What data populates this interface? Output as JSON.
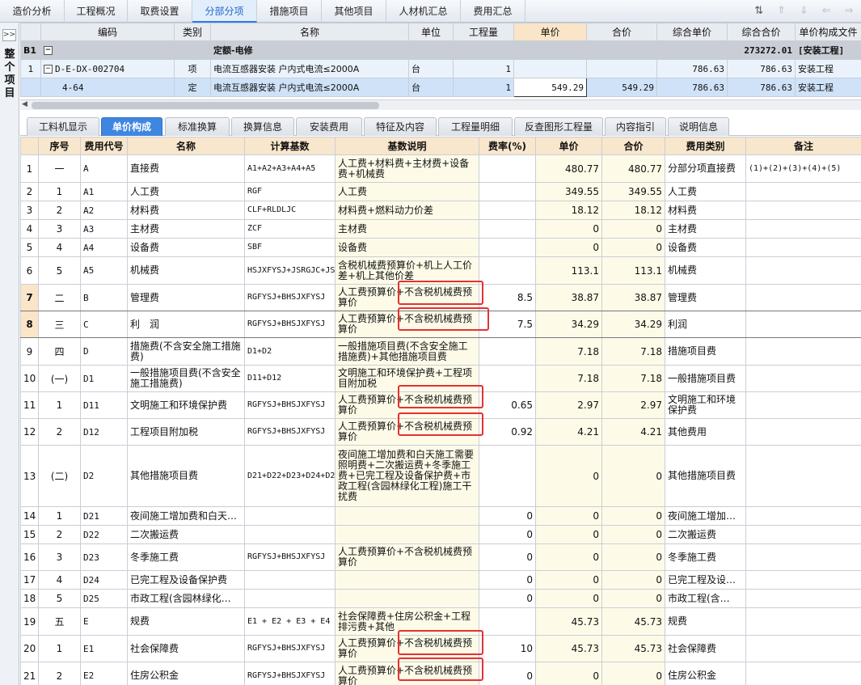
{
  "top_tabs": [
    {
      "label": "造价分析",
      "active": false
    },
    {
      "label": "工程概况",
      "active": false
    },
    {
      "label": "取费设置",
      "active": false
    },
    {
      "label": "分部分项",
      "active": true
    },
    {
      "label": "措施项目",
      "active": false
    },
    {
      "label": "其他项目",
      "active": false
    },
    {
      "label": "人材机汇总",
      "active": false
    },
    {
      "label": "费用汇总",
      "active": false
    }
  ],
  "toolbar_icons": [
    "sort-icon",
    "move-top-icon",
    "move-down-icon",
    "arrow-left-icon",
    "arrow-right-icon"
  ],
  "side": {
    "expand": ">>",
    "label": "整个项目"
  },
  "upper": {
    "headers": [
      "",
      "编码",
      "类别",
      "名称",
      "单位",
      "工程量",
      "单价",
      "合价",
      "综合单价",
      "综合合价",
      "单价构成文件"
    ],
    "selected_header": "单价",
    "group": {
      "code": "B1",
      "toggle": "−",
      "name": "定额-电修",
      "total": "273272.01",
      "file": "[安装工程]"
    },
    "rows": [
      {
        "no": "1",
        "toggle": "−",
        "code": "D-E-DX-002704",
        "type": "项",
        "name": "电流互感器安装 户内式电流≤2000A",
        "unit": "台",
        "qty": "1",
        "price": "",
        "amount": "",
        "comp_price": "786.63",
        "comp_amount": "786.63",
        "file": "安装工程"
      },
      {
        "no": "",
        "toggle": "",
        "code": "4-64",
        "type": "定",
        "name": "电流互感器安装 户内式电流≤2000A",
        "unit": "台",
        "qty": "1",
        "price": "549.29",
        "amount": "549.29",
        "comp_price": "786.63",
        "comp_amount": "786.63",
        "file": "安装工程"
      }
    ]
  },
  "sub_tabs": [
    {
      "label": "工料机显示",
      "active": false
    },
    {
      "label": "单价构成",
      "active": true
    },
    {
      "label": "标准换算",
      "active": false
    },
    {
      "label": "换算信息",
      "active": false
    },
    {
      "label": "安装费用",
      "active": false
    },
    {
      "label": "特征及内容",
      "active": false
    },
    {
      "label": "工程量明细",
      "active": false
    },
    {
      "label": "反查图形工程量",
      "active": false
    },
    {
      "label": "内容指引",
      "active": false
    },
    {
      "label": "说明信息",
      "active": false
    }
  ],
  "lower": {
    "headers": [
      "",
      "序号",
      "费用代号",
      "名称",
      "计算基数",
      "基数说明",
      "费率(%)",
      "单价",
      "合价",
      "费用类别",
      "备注"
    ],
    "rows": [
      {
        "n": "1",
        "seq": "一",
        "code": "A",
        "name": "直接费",
        "base": "A1+A2+A3+A4+A5",
        "desc": "人工费+材料费+主材费+设备费+机械费",
        "rate": "",
        "price": "480.77",
        "amount": "480.77",
        "cat": "分部分项直接费",
        "note": "(1)+(2)+(3)+(4)+(5)"
      },
      {
        "n": "2",
        "seq": "1",
        "code": "A1",
        "name": "人工费",
        "base": "RGF",
        "desc": "人工费",
        "rate": "",
        "price": "349.55",
        "amount": "349.55",
        "cat": "人工费",
        "note": ""
      },
      {
        "n": "3",
        "seq": "2",
        "code": "A2",
        "name": "材料费",
        "base": "CLF+RLDLJC",
        "desc": "材料费+燃料动力价差",
        "rate": "",
        "price": "18.12",
        "amount": "18.12",
        "cat": "材料费",
        "note": ""
      },
      {
        "n": "4",
        "seq": "3",
        "code": "A3",
        "name": "主材费",
        "base": "ZCF",
        "desc": "主材费",
        "rate": "",
        "price": "0",
        "amount": "0",
        "cat": "主材费",
        "note": ""
      },
      {
        "n": "5",
        "seq": "4",
        "code": "A4",
        "name": "设备费",
        "base": "SBF",
        "desc": "设备费",
        "rate": "",
        "price": "0",
        "amount": "0",
        "cat": "设备费",
        "note": ""
      },
      {
        "n": "6",
        "seq": "5",
        "code": "A5",
        "name": "机械费",
        "base": "HSJXFYSJ+JSRGJC+JSQTJC",
        "desc": "含税机械费预算价+机上人工价差+机上其他价差",
        "rate": "",
        "price": "113.1",
        "amount": "113.1",
        "cat": "机械费",
        "note": ""
      },
      {
        "n": "7",
        "seq": "二",
        "code": "B",
        "name": "管理费",
        "base": "RGFYSJ+BHSJXFYSJ",
        "desc": "人工费预算价+不含税机械费预算价",
        "rate": "8.5",
        "price": "38.87",
        "amount": "38.87",
        "cat": "管理费",
        "note": ""
      },
      {
        "n": "8",
        "seq": "三",
        "code": "C",
        "name": "利　润",
        "base": "RGFYSJ+BHSJXFYSJ",
        "desc": "人工费预算价+不含税机械费预算价",
        "rate": "7.5",
        "price": "34.29",
        "amount": "34.29",
        "cat": "利润",
        "note": ""
      },
      {
        "n": "9",
        "seq": "四",
        "code": "D",
        "name": "措施费(不含安全施工措施费)",
        "base": "D1+D2",
        "desc": "一般措施项目费(不含安全施工措施费)+其他措施项目费",
        "rate": "",
        "price": "7.18",
        "amount": "7.18",
        "cat": "措施项目费",
        "note": ""
      },
      {
        "n": "10",
        "seq": "(一)",
        "code": "D1",
        "name": "一般措施项目费(不含安全施工措施费)",
        "base": "D11+D12",
        "desc": "文明施工和环境保护费+工程项目附加税",
        "rate": "",
        "price": "7.18",
        "amount": "7.18",
        "cat": "一般措施项目费",
        "note": ""
      },
      {
        "n": "11",
        "seq": "1",
        "code": "D11",
        "name": "文明施工和环境保护费",
        "base": "RGFYSJ+BHSJXFYSJ",
        "desc": "人工费预算价+不含税机械费预算价",
        "rate": "0.65",
        "price": "2.97",
        "amount": "2.97",
        "cat": "文明施工和环境保护费",
        "note": ""
      },
      {
        "n": "12",
        "seq": "2",
        "code": "D12",
        "name": "工程项目附加税",
        "base": "RGFYSJ+BHSJXFYSJ",
        "desc": "人工费预算价+不含税机械费预算价",
        "rate": "0.92",
        "price": "4.21",
        "amount": "4.21",
        "cat": "其他费用",
        "note": ""
      },
      {
        "n": "13",
        "seq": "(二)",
        "code": "D2",
        "name": "其他措施项目费",
        "base": "D21+D22+D23+D24+D25",
        "desc": "夜间施工增加费和白天施工需要照明费+二次搬运费+冬季施工费+已完工程及设备保护费+市政工程(含园林绿化工程)施工干扰费",
        "rate": "",
        "price": "0",
        "amount": "0",
        "cat": "其他措施项目费",
        "note": ""
      },
      {
        "n": "14",
        "seq": "1",
        "code": "D21",
        "name": "夜间施工增加费和白天…",
        "base": "",
        "desc": "",
        "rate": "0",
        "price": "0",
        "amount": "0",
        "cat": "夜间施工增加…",
        "note": ""
      },
      {
        "n": "15",
        "seq": "2",
        "code": "D22",
        "name": "二次搬运费",
        "base": "",
        "desc": "",
        "rate": "0",
        "price": "0",
        "amount": "0",
        "cat": "二次搬运费",
        "note": ""
      },
      {
        "n": "16",
        "seq": "3",
        "code": "D23",
        "name": "冬季施工费",
        "base": "RGFYSJ+BHSJXFYSJ",
        "desc": "人工费预算价+不含税机械费预算价",
        "rate": "0",
        "price": "0",
        "amount": "0",
        "cat": "冬季施工费",
        "note": ""
      },
      {
        "n": "17",
        "seq": "4",
        "code": "D24",
        "name": "已完工程及设备保护费",
        "base": "",
        "desc": "",
        "rate": "0",
        "price": "0",
        "amount": "0",
        "cat": "已完工程及设…",
        "note": ""
      },
      {
        "n": "18",
        "seq": "5",
        "code": "D25",
        "name": "市政工程(含园林绿化…",
        "base": "",
        "desc": "",
        "rate": "0",
        "price": "0",
        "amount": "0",
        "cat": "市政工程(含…",
        "note": ""
      },
      {
        "n": "19",
        "seq": "五",
        "code": "E",
        "name": "规费",
        "base": "E1 + E2 + E3 + E4",
        "desc": "社会保障费+住房公积金+工程排污费+其他",
        "rate": "",
        "price": "45.73",
        "amount": "45.73",
        "cat": "规费",
        "note": ""
      },
      {
        "n": "20",
        "seq": "1",
        "code": "E1",
        "name": "社会保障费",
        "base": "RGFYSJ+BHSJXFYSJ",
        "desc": "人工费预算价+不含税机械费预算价",
        "rate": "10",
        "price": "45.73",
        "amount": "45.73",
        "cat": "社会保障费",
        "note": ""
      },
      {
        "n": "21",
        "seq": "2",
        "code": "E2",
        "name": "住房公积金",
        "base": "RGFYSJ+BHSJXFYSJ",
        "desc": "人工费预算价+不含税机械费预算价",
        "rate": "0",
        "price": "0",
        "amount": "0",
        "cat": "住房公积金",
        "note": ""
      }
    ]
  },
  "highlight_color": "#e33232"
}
